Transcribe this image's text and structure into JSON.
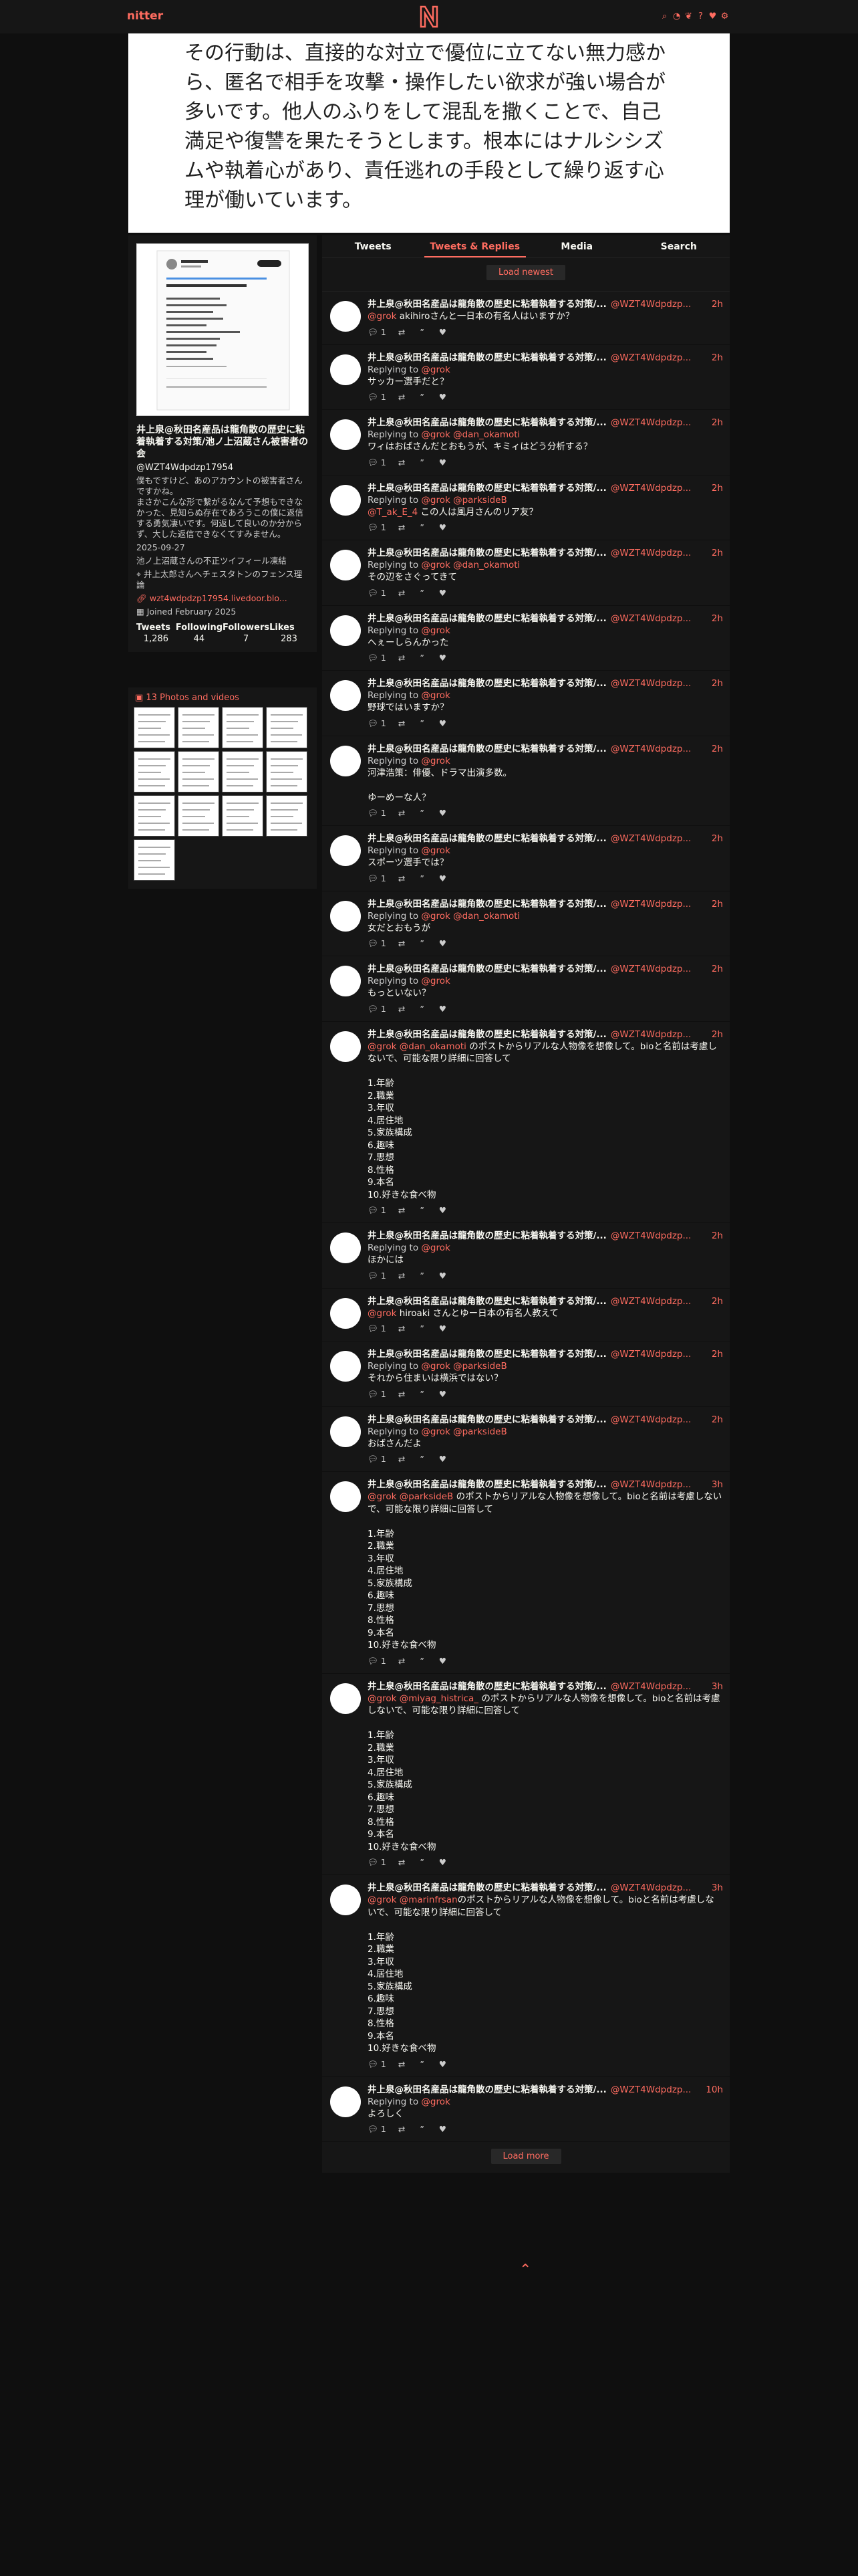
{
  "app": {
    "brand": "nitter"
  },
  "nav_icons": [
    "search-icon",
    "rss-icon",
    "twitter-icon",
    "info-icon",
    "heart-icon",
    "gear-icon"
  ],
  "colors": {
    "accent": "#ff6c60",
    "bg": "#0f0f0f",
    "panel": "#161616"
  },
  "banner": {
    "text": "その行動は、直接的な対立で優位に立てない無力感から、匿名で相手を攻撃・操作したい欲求が強い場合が多いです。他人のふりをして混乱を撒くことで、自己満足や復讐を果たそうとします。根本にはナルシシズムや執着心があり、責任逃れの手段として繰り返す心理が働いています。"
  },
  "profile": {
    "name": "井上泉@秋田名産品は龍角散の歴史に粘着執着する対策/池ノ上沼蔵さん被害者の会",
    "handle": "@WZT4Wdpdzp17954",
    "bio": "僕もですけど、あのアカウントの被害者さんですかね。\nまさかこんな形で繋がるなんて予想もできなかった、見知らぬ存在であろうこの僕に返信する勇気凄いです。何返して良いのか分からず、大した返信できなくてすみません。",
    "date": "2025-09-27",
    "note": "池ノ上沼蔵さんの不正ツイフィール凍結",
    "location": "井上太郎さんへチェスタトンのフェンス理論",
    "website": "wzt4wdpdzp17954.livedoor.blo...",
    "joined": "Joined February 2025",
    "stats": {
      "labels": [
        "Tweets",
        "Following",
        "Followers",
        "Likes"
      ],
      "values": [
        "1,286",
        "44",
        "7",
        "283"
      ]
    }
  },
  "media": {
    "label": "13 Photos and videos"
  },
  "tabs": [
    "Tweets",
    "Tweets & Replies",
    "Media",
    "Search"
  ],
  "timeline": {
    "load_newest": "Load newest",
    "load_more": "Load more",
    "name": "井上泉@秋田名産品は龍角散の歴史に粘着執着する対策/...",
    "handle": "@WZT4Wdpdzp...",
    "replying": "Replying to",
    "tweets": [
      {
        "time": "2h",
        "reply": "",
        "mentions": "@grok",
        "body": " akihiroさんと一日本の有名人はいますか？",
        "stats": [
          "1",
          "",
          ""
        ]
      },
      {
        "time": "2h",
        "reply": "@grok",
        "mentions": "",
        "body": "サッカー選手だと？",
        "stats": [
          "1",
          "",
          ""
        ]
      },
      {
        "time": "2h",
        "reply": "@grok @dan_okamoti",
        "mentions": "",
        "body": "ワィはおばさんだとおもうが、キミィはどう分析する？",
        "stats": [
          "1",
          "",
          ""
        ]
      },
      {
        "time": "2h",
        "reply": "@grok @parksideB",
        "mentions": "@T_ak_E_4",
        "body": " この人は風月さんのリア友？",
        "stats": [
          "1",
          "",
          ""
        ]
      },
      {
        "time": "2h",
        "reply": "@grok @dan_okamoti",
        "mentions": "",
        "body": "その辺をさぐってきて",
        "stats": [
          "1",
          "",
          ""
        ]
      },
      {
        "time": "2h",
        "reply": "@grok",
        "mentions": "",
        "body": "へぇーしらんかった",
        "stats": [
          "1",
          "",
          ""
        ]
      },
      {
        "time": "2h",
        "reply": "@grok",
        "mentions": "",
        "body": "野球ではいますか？",
        "stats": [
          "1",
          "",
          ""
        ]
      },
      {
        "time": "2h",
        "reply": "@grok",
        "mentions": "",
        "body": "河津浩策：俳優、ドラマ出演多数。\n\nゆーめーな人？",
        "stats": [
          "1",
          "",
          ""
        ]
      },
      {
        "time": "2h",
        "reply": "@grok",
        "mentions": "",
        "body": "スポーツ選手では？",
        "stats": [
          "1",
          "",
          ""
        ]
      },
      {
        "time": "2h",
        "reply": "@grok @dan_okamoti",
        "mentions": "",
        "body": "女だとおもうが",
        "stats": [
          "1",
          "",
          ""
        ]
      },
      {
        "time": "2h",
        "reply": "@grok",
        "mentions": "",
        "body": "もっといない？",
        "stats": [
          "1",
          "",
          ""
        ]
      },
      {
        "time": "2h",
        "reply": "",
        "mentions": "@grok @dan_okamoti",
        "body": " のポストからリアルな人物像を想像して。bioと名前は考慮しないで、可能な限り詳細に回答して\n\n1.年齢\n2.職業\n3.年収\n4.居住地\n5.家族構成\n6.趣味\n7.思想\n8.性格\n9.本名\n10.好きな食べ物",
        "stats": [
          "1",
          "",
          ""
        ]
      },
      {
        "time": "2h",
        "reply": "@grok",
        "mentions": "",
        "body": "ほかには",
        "stats": [
          "1",
          "",
          ""
        ]
      },
      {
        "time": "2h",
        "reply": "",
        "mentions": "@grok",
        "body": " hiroaki さんとゆー日本の有名人教えて",
        "stats": [
          "1",
          "",
          ""
        ]
      },
      {
        "time": "2h",
        "reply": "@grok @parksideB",
        "mentions": "",
        "body": "それから住まいは横浜ではない？",
        "stats": [
          "1",
          "",
          ""
        ]
      },
      {
        "time": "2h",
        "reply": "@grok @parksideB",
        "mentions": "",
        "body": "おばさんだよ",
        "stats": [
          "1",
          "",
          ""
        ]
      },
      {
        "time": "3h",
        "reply": "",
        "mentions": "@grok @parksideB",
        "body": " のポストからリアルな人物像を想像して。bioと名前は考慮しないで、可能な限り詳細に回答して\n\n1.年齢\n2.職業\n3.年収\n4.居住地\n5.家族構成\n6.趣味\n7.思想\n8.性格\n9.本名\n10.好きな食べ物",
        "stats": [
          "1",
          "",
          ""
        ]
      },
      {
        "time": "3h",
        "reply": "",
        "mentions": "@grok @miyag_histrica_",
        "body": " のポストからリアルな人物像を想像して。bioと名前は考慮しないで、可能な限り詳細に回答して\n\n1.年齢\n2.職業\n3.年収\n4.居住地\n5.家族構成\n6.趣味\n7.思想\n8.性格\n9.本名\n10.好きな食べ物",
        "stats": [
          "1",
          "",
          ""
        ]
      },
      {
        "time": "3h",
        "reply": "",
        "mentions": "@grok @marinfrsan",
        "body": "のポストからリアルな人物像を想像して。bioと名前は考慮しないで、可能な限り詳細に回答して\n\n1.年齢\n2.職業\n3.年収\n4.居住地\n5.家族構成\n6.趣味\n7.思想\n8.性格\n9.本名\n10.好きな食べ物",
        "stats": [
          "1",
          "",
          ""
        ]
      },
      {
        "time": "10h",
        "reply": "@grok",
        "mentions": "",
        "body": "よろしく",
        "stats": [
          "1",
          "",
          ""
        ]
      }
    ]
  }
}
